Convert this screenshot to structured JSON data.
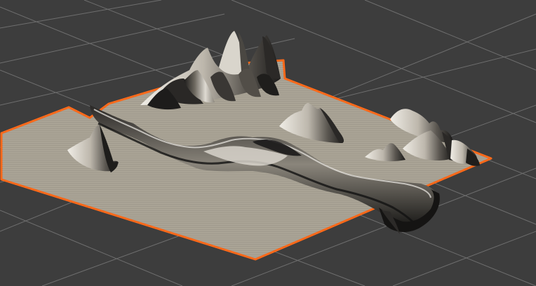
{
  "viewport": {
    "colors": {
      "background": "#3d3d3d",
      "grid_line": "#777777",
      "terrain_surface": "#aaa496",
      "selection_outline": "#ff6a1a",
      "shadow": "#1a1a1a",
      "highlight": "#e6e3dd"
    }
  }
}
